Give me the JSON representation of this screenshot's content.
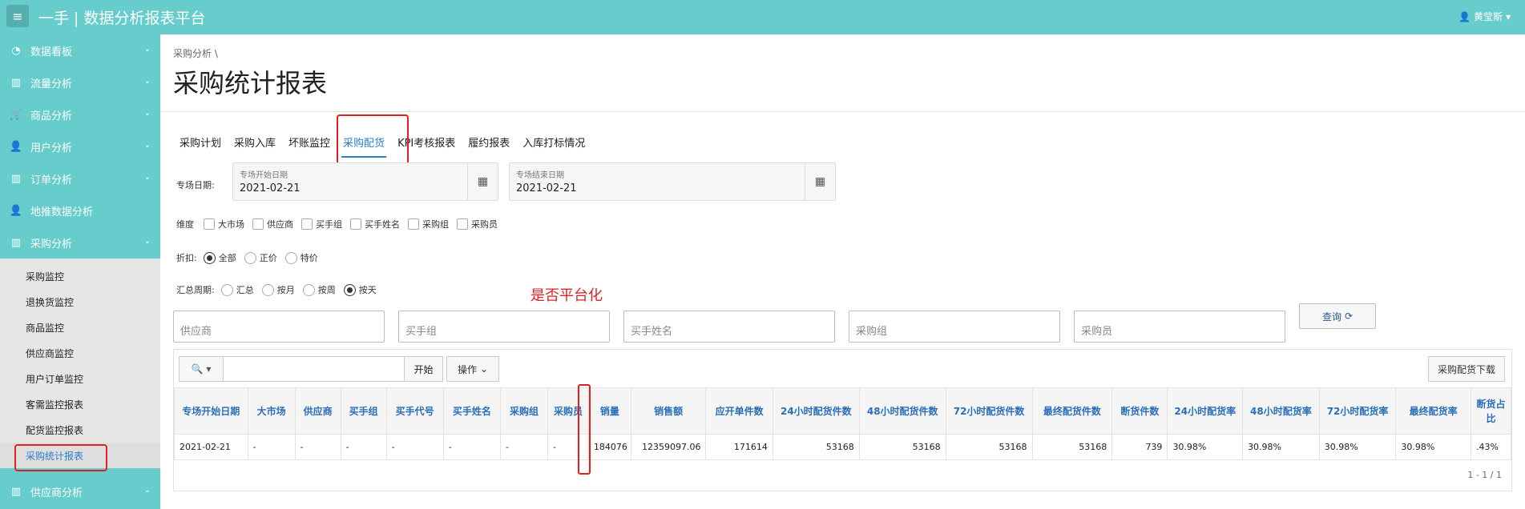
{
  "header": {
    "title": "一手 | 数据分析报表平台",
    "user": "黄莹斯"
  },
  "sidebar": {
    "items": [
      {
        "label": "数据看板",
        "icon": "gauge-icon"
      },
      {
        "label": "流量分析",
        "icon": "bar-chart-icon"
      },
      {
        "label": "商品分析",
        "icon": "cart-icon"
      },
      {
        "label": "用户分析",
        "icon": "user-icon"
      },
      {
        "label": "订单分析",
        "icon": "bar-chart-icon"
      },
      {
        "label": "地推数据分析",
        "icon": "user-plus-icon"
      },
      {
        "label": "采购分析",
        "icon": "bar-chart-icon"
      }
    ],
    "sub_items": [
      "采购监控",
      "退换货监控",
      "商品监控",
      "供应商监控",
      "用户订单监控",
      "客需监控报表",
      "配货监控报表",
      "采购统计报表"
    ],
    "bottom_item": "供应商分析"
  },
  "breadcrumb": "采购分析",
  "page_title": "采购统计报表",
  "tabs": [
    "采购计划",
    "采购入库",
    "坏账监控",
    "采购配货",
    "KPI考核报表",
    "履约报表",
    "入库打标情况"
  ],
  "form": {
    "date_label": "专场日期:",
    "start_label": "专场开始日期",
    "start_value": "2021-02-21",
    "end_label": "专场结束日期",
    "end_value": "2021-02-21",
    "dim_label": "维度",
    "dims": [
      "大市场",
      "供应商",
      "买手组",
      "买手姓名",
      "采购组",
      "采购员"
    ],
    "discount_label": "折扣:",
    "discounts": [
      "全部",
      "正价",
      "特价"
    ],
    "period_label": "汇总周期:",
    "periods": [
      "汇总",
      "按月",
      "按周",
      "按天"
    ]
  },
  "filters": [
    "供应商",
    "买手组",
    "买手姓名",
    "采购组",
    "采购员"
  ],
  "query_label": "查询",
  "report": {
    "go_label": "开始",
    "ops_label": "操作",
    "download_label": "采购配货下载",
    "columns": [
      "专场开始日期",
      "大市场",
      "供应商",
      "买手组",
      "买手代号",
      "买手姓名",
      "采购组",
      "采购员",
      "销量",
      "销售额",
      "应开单件数",
      "24小时配货件数",
      "48小时配货件数",
      "72小时配货件数",
      "最终配货件数",
      "断货件数",
      "24小时配货率",
      "48小时配货率",
      "72小时配货率",
      "最终配货率",
      "断货占比"
    ],
    "row": [
      "2021-02-21",
      "-",
      "-",
      "-",
      "-",
      "-",
      "-",
      "-",
      "184076",
      "12359097.06",
      "171614",
      "53168",
      "53168",
      "53168",
      "53168",
      "739",
      "30.98%",
      "30.98%",
      "30.98%",
      "30.98%",
      ".43%"
    ],
    "pager": "1 - 1 / 1"
  },
  "annotation": "是否平台化",
  "colors": {
    "teal": "#66cccc",
    "accent": "#2a7fc9",
    "annotation": "#e02020"
  }
}
